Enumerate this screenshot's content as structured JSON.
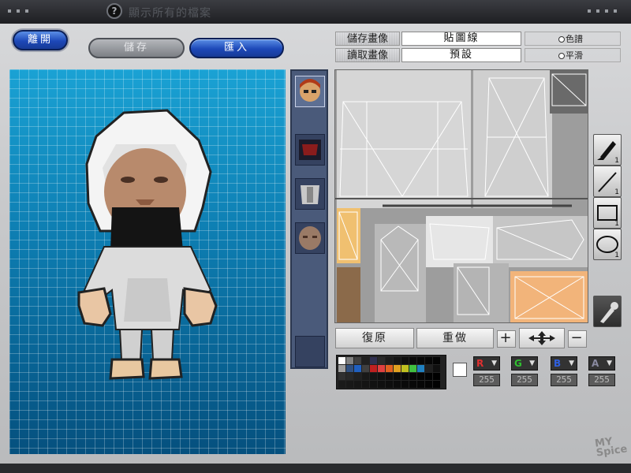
{
  "window": {
    "title": "顯示所有的檔案",
    "help_icon": "?"
  },
  "top_buttons": {
    "exit": "離開",
    "save": "儲存",
    "import": "匯入"
  },
  "texture": {
    "save_image": "儲存畫像",
    "load_image": "讀取畫像",
    "map_label": "貼圖線",
    "preset": "預設"
  },
  "options": {
    "palette": "色譜",
    "smooth": "平滑"
  },
  "tools": {
    "brush_count": "1",
    "line_count": "1",
    "rect_count": "1",
    "ellipse_count": "1"
  },
  "actions": {
    "restore": "復原",
    "redo": "重做",
    "zoom_in": "+",
    "zoom_out": "−"
  },
  "color": {
    "r_label": "R",
    "g_label": "G",
    "b_label": "B",
    "a_label": "A",
    "r": "255",
    "g": "255",
    "b": "255",
    "a": "255",
    "current": "#ffffff"
  },
  "palette_colors": [
    "#ffffff",
    "#808080",
    "#404040",
    "#202020",
    "#303050",
    "#2a2a2a",
    "#1c1c1c",
    "#141414",
    "#0e0e0e",
    "#0a0a0a",
    "#080808",
    "#060606",
    "#040404",
    "#a0a0a0",
    "#305080",
    "#2060c0",
    "#404040",
    "#c02020",
    "#e04040",
    "#e06020",
    "#e0a020",
    "#c0c020",
    "#40c040",
    "#2080c0",
    "#202020",
    "#101010",
    "#303030",
    "#282828",
    "#202020",
    "#181818",
    "#141414",
    "#101010",
    "#0c0c0c",
    "#0a0a0a",
    "#080808",
    "#060606",
    "#040404",
    "#020202",
    "#000000",
    "#1a1a1a",
    "#181818",
    "#161616",
    "#141414",
    "#121212",
    "#101010",
    "#0e0e0e",
    "#0c0c0c",
    "#0a0a0a",
    "#080808",
    "#060606",
    "#040404",
    "#020202"
  ],
  "watermark": {
    "line1": "MY",
    "line2": "Spice"
  }
}
